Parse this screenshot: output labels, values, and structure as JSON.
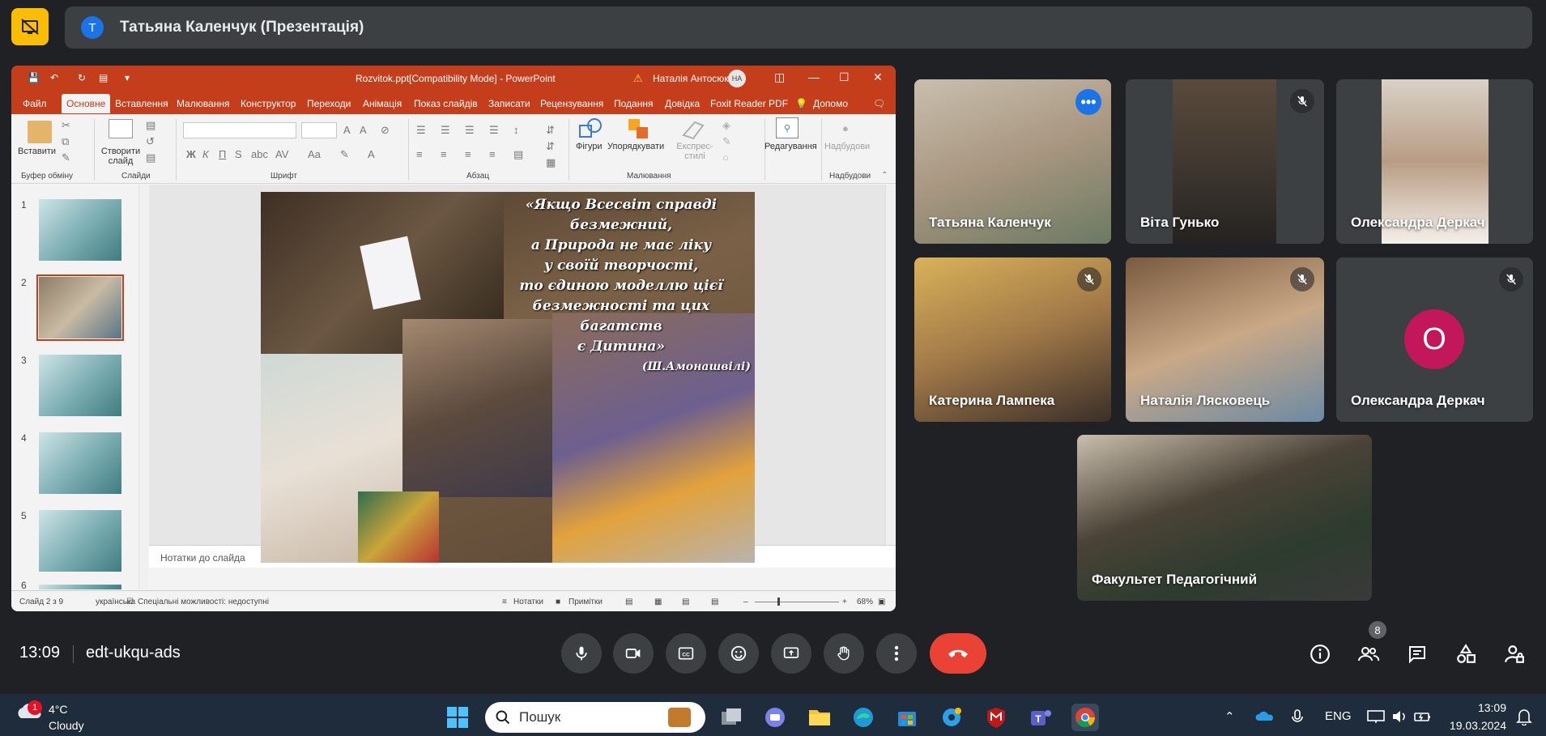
{
  "presenter_bar": {
    "avatar_letter": "T",
    "title": "Татьяна Каленчук (Презентація)"
  },
  "powerpoint": {
    "file_title": "Rozvitok.ppt[Compatibility Mode]  -  PowerPoint",
    "user_name": "Наталія Антосюк",
    "user_initials": "НА",
    "menu": [
      "Файл",
      "Основне",
      "Вставлення",
      "Малювання",
      "Конструктор",
      "Переходи",
      "Анімація",
      "Показ слайдів",
      "Записати",
      "Рецензування",
      "Подання",
      "Довідка",
      "Foxit Reader PDF",
      "Допомо"
    ],
    "active_menu": "Основне",
    "ribbon": {
      "paste": "Вставити",
      "new_slide": "Створити слайд",
      "clipboard_group": "Буфер обміну",
      "slides_group": "Слайди",
      "font_group": "Шрифт",
      "paragraph_group": "Абзац",
      "drawing_group": "Малювання",
      "addins_group": "Надбудови",
      "shapes": "Фігури",
      "arrange": "Упорядкувати",
      "quick_styles": "Експрес-стилі",
      "editing": "Редагування",
      "addins": "Надбудови"
    },
    "slide_numbers": [
      "1",
      "2",
      "3",
      "4",
      "5",
      "6"
    ],
    "selected_slide": "2",
    "quote_lines": [
      "«Якщо Всесвіт справді безмежний,",
      "а Природа не має ліку",
      "у своїй творчості,",
      "то єдиною моделлю цієї",
      "безмежності та цих багатств",
      "є Дитина»"
    ],
    "quote_author": "(Ш.Амонашвілі)",
    "notes_placeholder": "Нотатки до слайда",
    "status": {
      "slide_of": "Слайд 2 з 9",
      "language": "українська",
      "accessibility": "Спеціальні можливості: недоступні",
      "notes_btn": "Нотатки",
      "comments_btn": "Примітки",
      "zoom": "68%"
    }
  },
  "participants": [
    {
      "name": "Татьяна Каленчук",
      "state": "speaking"
    },
    {
      "name": "Віта Гунько",
      "state": "muted"
    },
    {
      "name": "Олександра Деркач",
      "state": "video"
    },
    {
      "name": "Катерина Лампека",
      "state": "muted"
    },
    {
      "name": "Наталія Лясковець",
      "state": "muted"
    },
    {
      "name": "Олександра Деркач",
      "state": "muted",
      "avatar_letter": "О"
    },
    {
      "name": "Факультет Педагогічний",
      "state": "video"
    }
  ],
  "meeting": {
    "time": "13:09",
    "code": "edt-ukqu-ads",
    "people_count": "8"
  },
  "colors": {
    "accent_blue": "#1a73e8",
    "end_call_red": "#ea4335",
    "present_yellow": "#fbbc04",
    "ppt_orange": "#c43e1c",
    "avatar_pink": "#c2185b"
  },
  "taskbar": {
    "temperature": "4°C",
    "condition": "Cloudy",
    "weather_badge": "1",
    "search_label": "Пошук",
    "language": "ENG",
    "clock": "13:09",
    "date": "19.03.2024"
  }
}
